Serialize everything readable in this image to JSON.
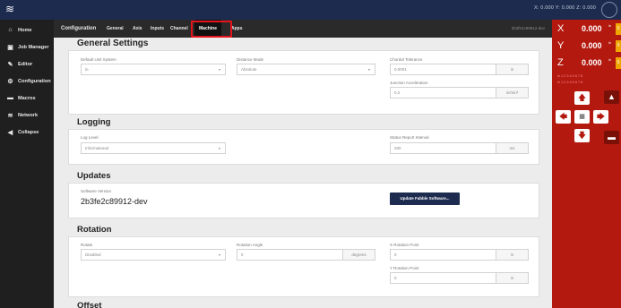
{
  "topbar": {
    "coords_text": "X: 0.000   Y: 0.000   Z: 0.000"
  },
  "sidebar": {
    "items": [
      {
        "label": "Home",
        "icon": "home-icon",
        "glyph": "🏠"
      },
      {
        "label": "Job Manager",
        "icon": "briefcase-icon",
        "glyph": "💼"
      },
      {
        "label": "Editor",
        "icon": "pencil-icon",
        "glyph": "✎"
      },
      {
        "label": "Configuration",
        "icon": "gear-icon",
        "glyph": "⚙"
      },
      {
        "label": "Macros",
        "icon": "folder-icon",
        "glyph": "▬"
      },
      {
        "label": "Network",
        "icon": "wifi-icon",
        "glyph": "≋"
      },
      {
        "label": "Collapse",
        "icon": "collapse-icon",
        "glyph": "◀"
      }
    ]
  },
  "tabs": {
    "title": "Configuration",
    "items": [
      "General",
      "Axis",
      "Inputs",
      "Channel",
      "Machine",
      "Apps"
    ],
    "active": "Machine",
    "right_text": "2b3fe2c89912-dev"
  },
  "general": {
    "title": "General Settings",
    "unit_system_label": "Default Unit System",
    "unit_system_value": "in",
    "distance_mode_label": "Distance Mode",
    "distance_mode_value": "Absolute",
    "chordal_label": "Chordal Tolerance",
    "chordal_value": "0.0001",
    "chordal_unit": "in",
    "junction_label": "Junction Acceleration",
    "junction_value": "0.2",
    "junction_unit": "in/min²"
  },
  "logging": {
    "title": "Logging",
    "level_label": "Log Level",
    "level_value": "Informational",
    "interval_label": "Status Report Interval",
    "interval_value": "200",
    "interval_unit": "ms"
  },
  "updates": {
    "title": "Updates",
    "version_label": "Software Version",
    "version_value": "2b3fe2c89912-dev",
    "update_button": "Update Fabble Software..."
  },
  "rotation": {
    "title": "Rotation",
    "rotate_label": "Rotate",
    "rotate_value": "Disabled",
    "angle_label": "Rotation Angle",
    "angle_value": "0",
    "angle_unit": "degrees",
    "xpoint_label": "X Rotation Point",
    "xpoint_value": "0",
    "xpoint_unit": "in",
    "ypoint_label": "Y Rotation Point",
    "ypoint_value": "0",
    "ypoint_unit": "in"
  },
  "offset": {
    "title": "Offset"
  },
  "dro": {
    "x_letter": "X",
    "x_value": "0.000",
    "x_unit": "in",
    "y_letter": "Y",
    "y_value": "0.000",
    "y_unit": "in",
    "z_letter": "Z",
    "z_value": "0.000",
    "z_unit": "in",
    "zero_label": "0",
    "limits_line1": "lo  1 2 3 4 5 6 7 8",
    "limits_line2": "hi  1 2 3 4 5 6 7 8"
  },
  "colors": {
    "topbar": "#1d2b4f",
    "sidebar": "#1f1f1f",
    "dro_panel": "#b3190f",
    "highlight": "#e3141b",
    "button": "#1d2b4f"
  }
}
